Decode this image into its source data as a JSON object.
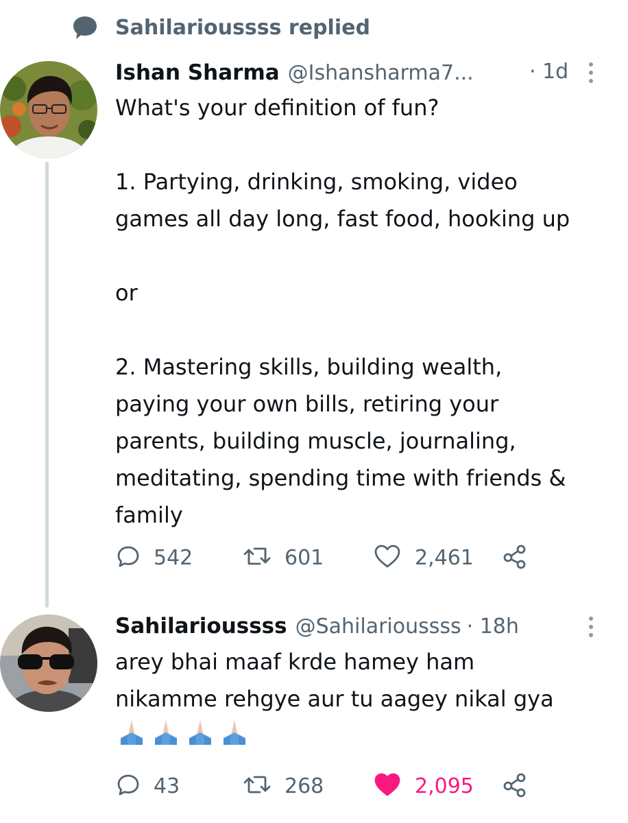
{
  "context": {
    "icon": "speech-bubble-icon",
    "label": "Sahilarioussss replied"
  },
  "tweets": [
    {
      "author": {
        "name": "Ishan Sharma",
        "handle": "@Ishansharma7...",
        "avatar": "avatar-photo"
      },
      "time": "· 1d",
      "text": "What's your definition of fun?\n\n1. Partying, drinking, smoking, video\ngames all day long, fast food, hooking up\n\nor\n\n2. Mastering skills, building wealth,\npaying your own bills, retiring your\nparents, building muscle, journaling,\nmeditating, spending time with friends &\nfamily",
      "stats": {
        "replies": "542",
        "retweets": "601",
        "likes": "2,461",
        "liked": false
      }
    },
    {
      "author": {
        "name": "Sahilarioussss",
        "handle": "@Sahilarioussss",
        "avatar": "avatar-photo"
      },
      "time": "· 18h",
      "text": "arey bhai maaf krde hamey ham\nnikamme rehgye aur tu aagey nikal gya",
      "emoji": "🙏🏻🙏🏻🙏🏻🙏🏻",
      "stats": {
        "replies": "43",
        "retweets": "268",
        "likes": "2,095",
        "liked": true
      }
    }
  ],
  "colors": {
    "text": "#0f1419",
    "secondary": "#536471",
    "like": "#f91880",
    "thread_line": "#cfd9de"
  }
}
